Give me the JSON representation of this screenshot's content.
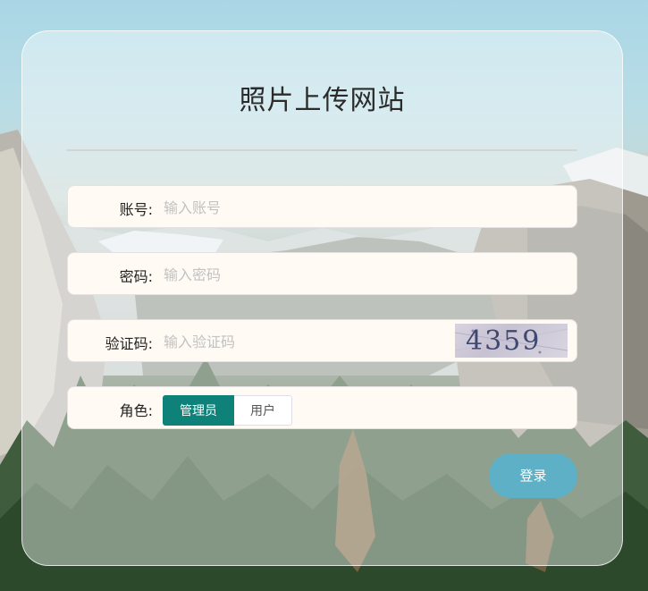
{
  "title": "照片上传网站",
  "form": {
    "account": {
      "label": "账号:",
      "placeholder": "输入账号",
      "value": ""
    },
    "password": {
      "label": "密码:",
      "placeholder": "输入密码",
      "value": ""
    },
    "captcha": {
      "label": "验证码:",
      "placeholder": "输入验证码",
      "value": "",
      "image_text": "4359"
    },
    "role": {
      "label": "角色:",
      "options": [
        "管理员",
        "用户"
      ],
      "selected": "管理员"
    }
  },
  "login_button": "登录",
  "colors": {
    "accent": "#0e8279",
    "login": "#5eb0c6"
  }
}
